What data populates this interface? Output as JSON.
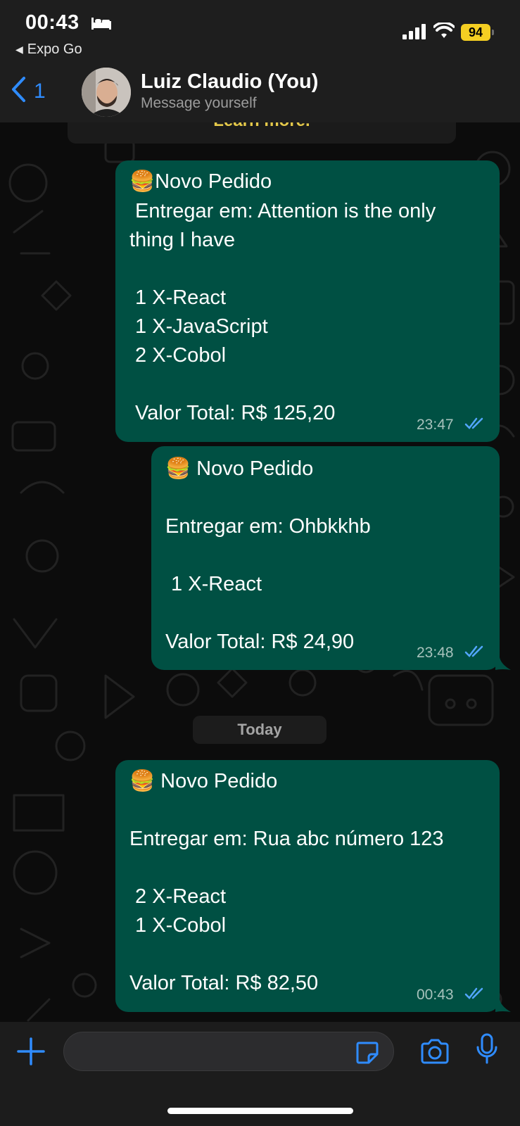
{
  "status_bar": {
    "time": "00:43",
    "back_app": "Expo Go",
    "battery": "94"
  },
  "header": {
    "back_count": "1",
    "contact_name": "Luiz Claudio (You)",
    "contact_subtitle": "Message yourself"
  },
  "chat": {
    "learn_more": "Learn more.",
    "date_separator": "Today",
    "messages": [
      {
        "lines": [
          "🍔Novo Pedido",
          " Entregar em: Attention is the only",
          "thing I have",
          "",
          " 1 X-React",
          " 1 X-JavaScript",
          " 2 X-Cobol",
          "",
          " Valor Total: R$ 125,20"
        ],
        "time": "23:47",
        "status": "read"
      },
      {
        "lines": [
          "🍔 Novo Pedido",
          "",
          "Entregar em: Ohbkkhb",
          "",
          " 1 X-React",
          "",
          "Valor Total: R$ 24,90"
        ],
        "time": "23:48",
        "status": "read"
      },
      {
        "lines": [
          "🍔 Novo Pedido",
          "",
          "Entregar em: Rua abc número 123",
          "",
          " 2 X-React",
          " 1 X-Cobol",
          "",
          "Valor Total: R$ 82,50"
        ],
        "time": "00:43",
        "status": "read"
      }
    ]
  },
  "composer": {
    "placeholder": ""
  },
  "colors": {
    "bubble": "#005043",
    "accent_blue": "#2f8cff",
    "read_tick": "#53a6ff",
    "learn_more": "#e5c94a",
    "battery": "#f5cf22"
  },
  "icons": [
    "bed-icon",
    "signal-icon",
    "wifi-icon",
    "chevron-left-icon",
    "plus-icon",
    "sticker-icon",
    "camera-icon",
    "microphone-icon",
    "double-check-icon"
  ]
}
